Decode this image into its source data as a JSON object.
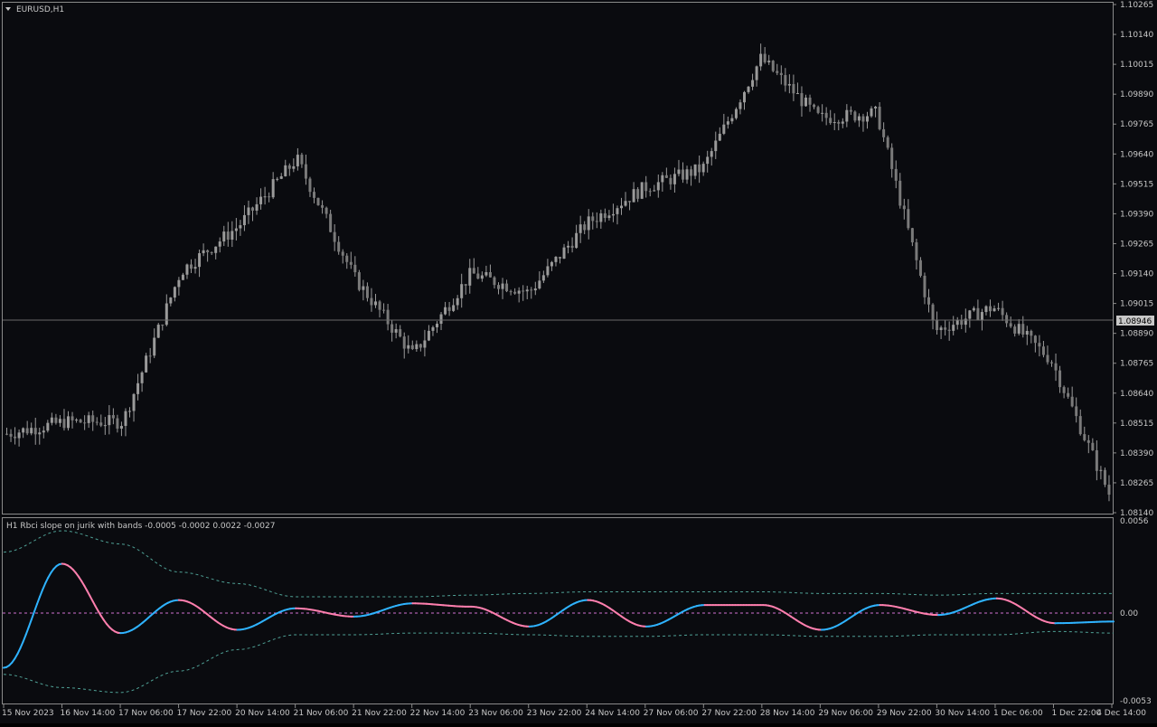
{
  "main_chart": {
    "symbol_label": "EURUSD,H1",
    "price_ticks": [
      "1.10265",
      "1.10140",
      "1.10015",
      "1.09890",
      "1.09765",
      "1.09640",
      "1.09515",
      "1.09390",
      "1.09265",
      "1.09140",
      "1.09015",
      "1.08890",
      "1.08765",
      "1.08640",
      "1.08515",
      "1.08390",
      "1.08265",
      "1.08140"
    ],
    "current_price": "1.08946"
  },
  "indicator": {
    "header": "H1  Rbci slope on jurik with bands  -0.0005 -0.0002 0.0022 -0.0027",
    "ticks": [
      "0.0056",
      "0.00",
      "-0.0053"
    ]
  },
  "time_axis": [
    "15 Nov 2023",
    "16 Nov 14:00",
    "17 Nov 06:00",
    "17 Nov 22:00",
    "20 Nov 14:00",
    "21 Nov 06:00",
    "21 Nov 22:00",
    "22 Nov 14:00",
    "23 Nov 06:00",
    "23 Nov 22:00",
    "24 Nov 14:00",
    "27 Nov 06:00",
    "27 Nov 22:00",
    "28 Nov 14:00",
    "29 Nov 06:00",
    "29 Nov 22:00",
    "30 Nov 14:00",
    "1 Dec 06:00",
    "1 Dec 22:00",
    "4 Dec 14:00"
  ],
  "colors": {
    "background": "#0a0b0f",
    "frame": "#8a8a8a",
    "candle": "#9a9a9a",
    "rising": "#2fb3ff",
    "falling": "#ff7fae",
    "band": "#4fa095",
    "zero_line": "#d070d0"
  },
  "chart_data": [
    {
      "type": "line",
      "title": "EURUSD,H1",
      "note_series": "hourly candlesticks (approximate close path)",
      "x": [
        "15 Nov 2023",
        "16 Nov 14:00",
        "17 Nov 06:00",
        "17 Nov 22:00",
        "20 Nov 14:00",
        "21 Nov 06:00",
        "21 Nov 22:00",
        "22 Nov 14:00",
        "23 Nov 06:00",
        "23 Nov 22:00",
        "24 Nov 14:00",
        "27 Nov 06:00",
        "27 Nov 22:00",
        "28 Nov 14:00",
        "29 Nov 06:00",
        "29 Nov 22:00",
        "30 Nov 14:00",
        "1 Dec 06:00",
        "1 Dec 22:00",
        "4 Dec 14:00"
      ],
      "series": [
        {
          "name": "",
          "values": [
            1.0847,
            1.0852,
            1.0852,
            1.0915,
            1.0934,
            1.0962,
            1.0912,
            1.088,
            1.0914,
            1.0906,
            1.0935,
            1.095,
            1.0958,
            1.1004,
            1.0979,
            1.0981,
            1.089,
            1.09,
            1.0878,
            1.0822
          ]
        }
      ],
      "ylim": [
        1.0814,
        1.10265
      ],
      "current_price": 1.08946
    },
    {
      "type": "line",
      "title": "Rbci slope on jurik with bands",
      "x": [
        "15 Nov 2023",
        "16 Nov 14:00",
        "17 Nov 06:00",
        "17 Nov 22:00",
        "20 Nov 14:00",
        "21 Nov 06:00",
        "21 Nov 22:00",
        "22 Nov 14:00",
        "23 Nov 06:00",
        "23 Nov 22:00",
        "24 Nov 14:00",
        "27 Nov 06:00",
        "27 Nov 22:00",
        "28 Nov 14:00",
        "29 Nov 06:00",
        "29 Nov 22:00",
        "30 Nov 14:00",
        "1 Dec 06:00",
        "1 Dec 22:00",
        "4 Dec 14:00"
      ],
      "series": [
        {
          "name": "",
          "values": [
            -0.0033,
            0.003,
            -0.0012,
            0.0008,
            -0.001,
            0.0003,
            -0.0002,
            0.0006,
            0.0004,
            -0.0008,
            0.0008,
            -0.0008,
            0.0005,
            0.0005,
            -0.001,
            0.0005,
            -0.0001,
            0.0009,
            -0.0006,
            -0.0005
          ]
        },
        {
          "name": "",
          "values": [
            0.0037,
            0.005,
            0.0042,
            0.0025,
            0.0018,
            0.001,
            0.001,
            0.001,
            0.0011,
            0.0012,
            0.0013,
            0.0013,
            0.0013,
            0.0013,
            0.0012,
            0.0012,
            0.0011,
            0.0012,
            0.0012,
            0.0012
          ]
        },
        {
          "name": "",
          "values": [
            -0.0037,
            -0.0045,
            -0.0048,
            -0.0035,
            -0.0022,
            -0.0013,
            -0.0013,
            -0.0012,
            -0.0012,
            -0.0013,
            -0.0014,
            -0.0014,
            -0.0013,
            -0.0013,
            -0.0014,
            -0.0014,
            -0.0013,
            -0.0013,
            -0.0011,
            -0.0012
          ]
        }
      ],
      "ylim": [
        -0.0053,
        0.0056
      ],
      "zero_line": 0.0
    }
  ]
}
